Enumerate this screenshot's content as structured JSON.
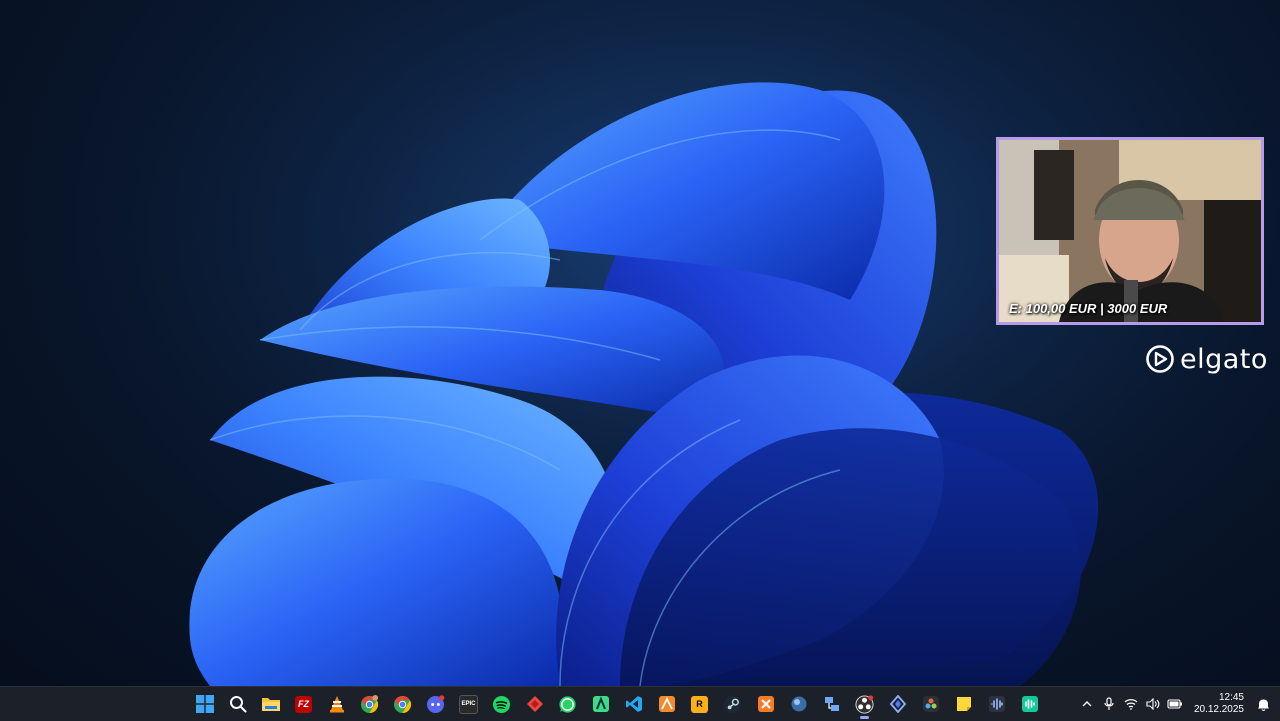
{
  "desktop": {
    "wallpaper_name": "windows-11-bloom",
    "accent": "#2e5bff"
  },
  "webcam": {
    "caption": "E: 100,00 EUR | 3000 EUR",
    "border_color": "#b79be8"
  },
  "brand": {
    "logo_text": "elgato"
  },
  "taskbar": {
    "apps": [
      {
        "name": "start",
        "icon": "windows-logo-icon"
      },
      {
        "name": "search",
        "icon": "search-icon"
      },
      {
        "name": "file-explorer",
        "icon": "folder-icon"
      },
      {
        "name": "filezilla",
        "icon": "filezilla-icon",
        "label": "FZ"
      },
      {
        "name": "vlc",
        "icon": "vlc-cone-icon"
      },
      {
        "name": "chrome-profile",
        "icon": "chrome-icon"
      },
      {
        "name": "chrome",
        "icon": "chrome-icon"
      },
      {
        "name": "discord",
        "icon": "discord-icon"
      },
      {
        "name": "epic-games",
        "icon": "epic-games-icon",
        "label": "EPIC"
      },
      {
        "name": "spotify",
        "icon": "spotify-icon"
      },
      {
        "name": "anydesk",
        "icon": "anydesk-icon"
      },
      {
        "name": "whatsapp",
        "icon": "whatsapp-icon"
      },
      {
        "name": "android-studio",
        "icon": "app-icon"
      },
      {
        "name": "vscode",
        "icon": "vscode-icon"
      },
      {
        "name": "affinity",
        "icon": "affinity-icon"
      },
      {
        "name": "rockstar",
        "icon": "rockstar-icon",
        "label": "R"
      },
      {
        "name": "steam",
        "icon": "steam-icon"
      },
      {
        "name": "xampp",
        "icon": "xampp-icon"
      },
      {
        "name": "app-sphere",
        "icon": "sphere-icon"
      },
      {
        "name": "network-tool",
        "icon": "network-icon"
      },
      {
        "name": "obs",
        "icon": "obs-icon",
        "active": true
      },
      {
        "name": "diamond-app",
        "icon": "diamond-icon"
      },
      {
        "name": "davinci-resolve",
        "icon": "davinci-icon"
      },
      {
        "name": "sticky-notes",
        "icon": "sticky-notes-icon"
      },
      {
        "name": "audio-app",
        "icon": "audio-wave-icon"
      },
      {
        "name": "wave-link",
        "icon": "wave-link-icon"
      }
    ]
  },
  "tray": {
    "icons": [
      "chevron-up-icon",
      "microphone-icon",
      "wifi-icon",
      "volume-icon",
      "battery-icon"
    ],
    "time": "12:45",
    "date": "20.12.2025",
    "notification_icon": "notification-icon"
  }
}
